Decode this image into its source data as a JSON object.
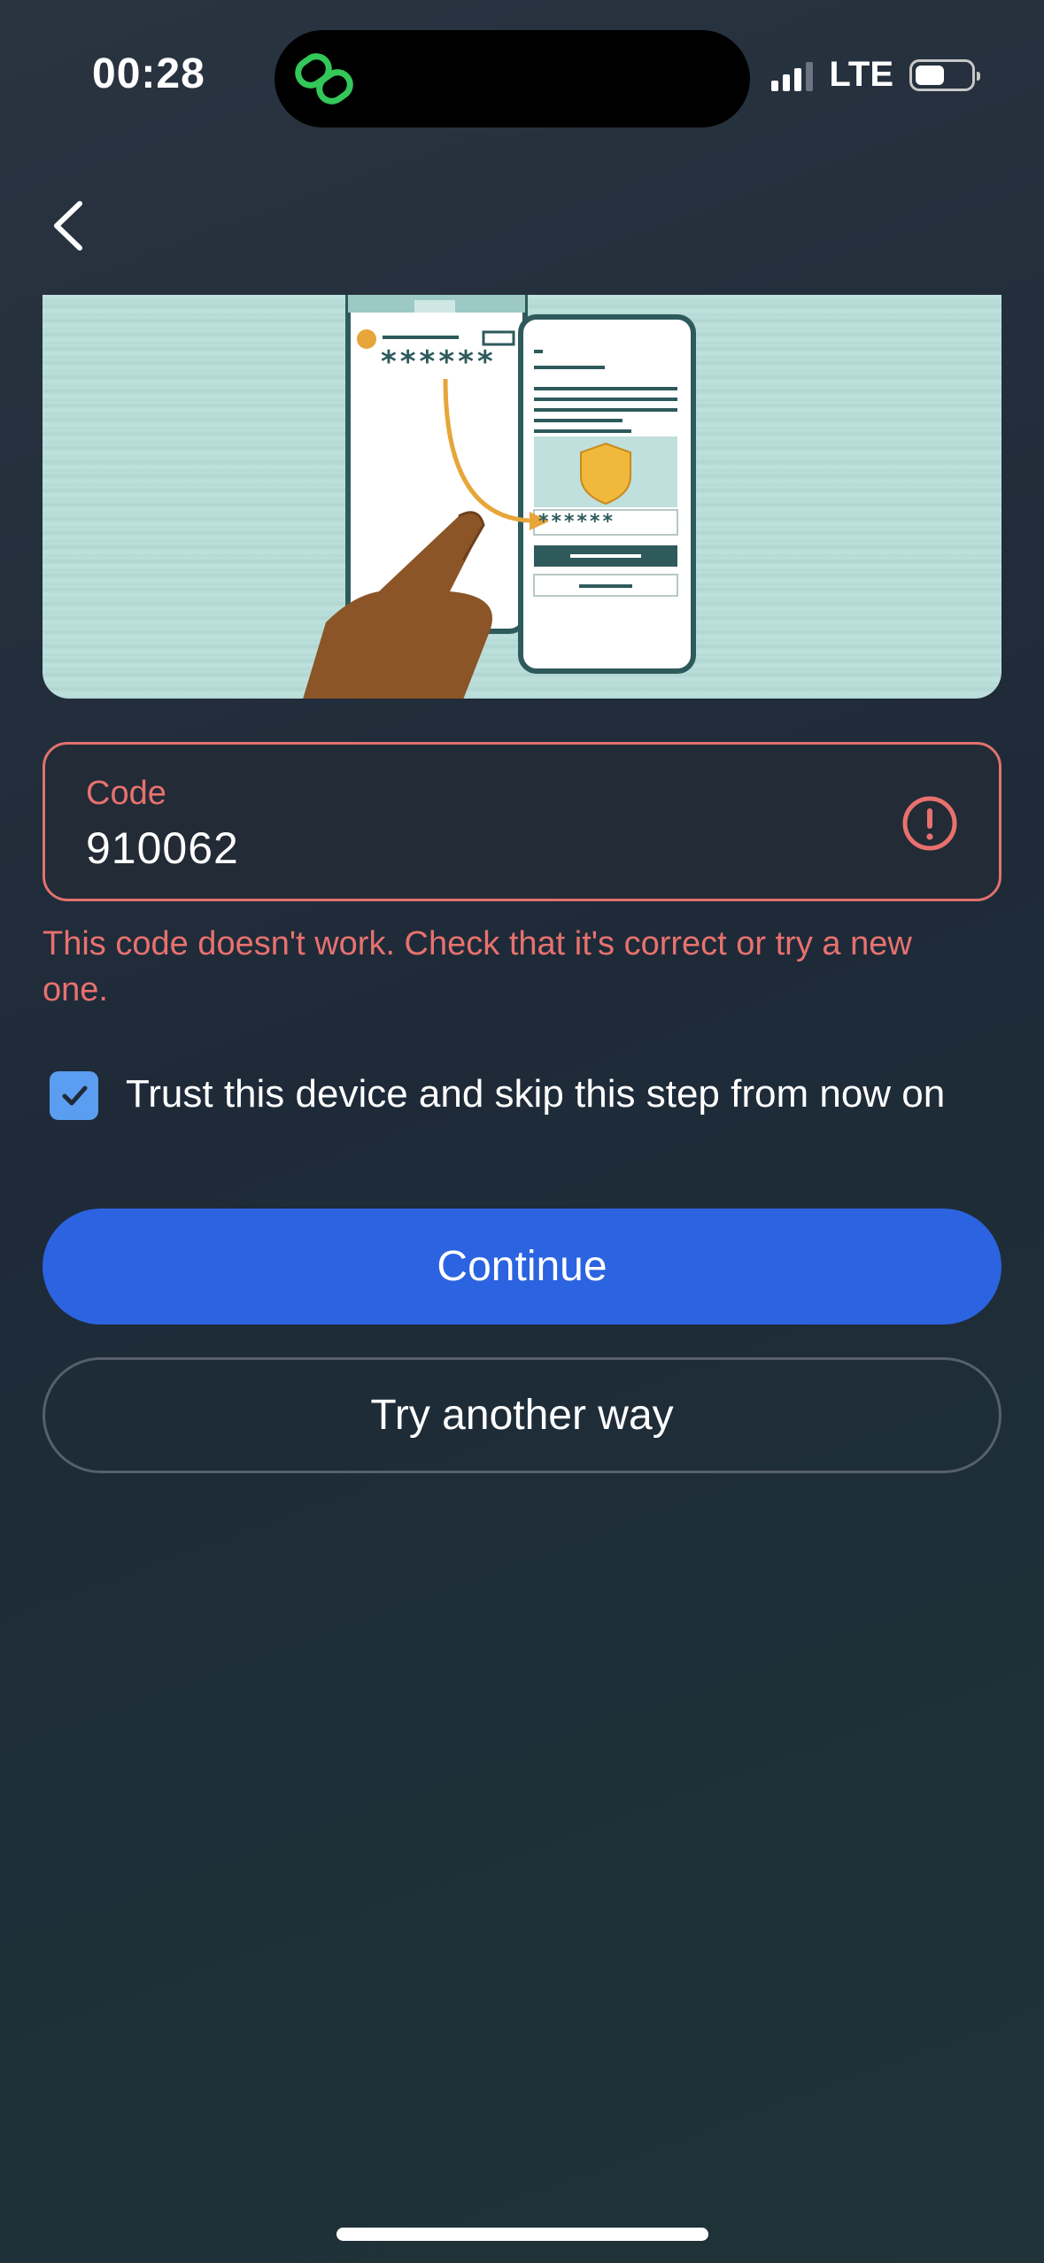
{
  "status_bar": {
    "time": "00:28",
    "network": "LTE",
    "signal_bars": 3,
    "battery_level": 0.45
  },
  "navigation": {
    "back_icon": "chevron-left-icon"
  },
  "illustration": {
    "password_mask": "******"
  },
  "code_field": {
    "label": "Code",
    "value": "910062",
    "status_icon": "error-circle-icon"
  },
  "error_message": "This code doesn't work. Check that it's correct or try a new one.",
  "trust_device": {
    "checked": true,
    "label": "Trust this device and skip this step from now on"
  },
  "buttons": {
    "continue": "Continue",
    "try_another": "Try another way"
  },
  "colors": {
    "accent": "#2c63e0",
    "error": "#e8716e",
    "checkbox": "#5b9df0"
  }
}
